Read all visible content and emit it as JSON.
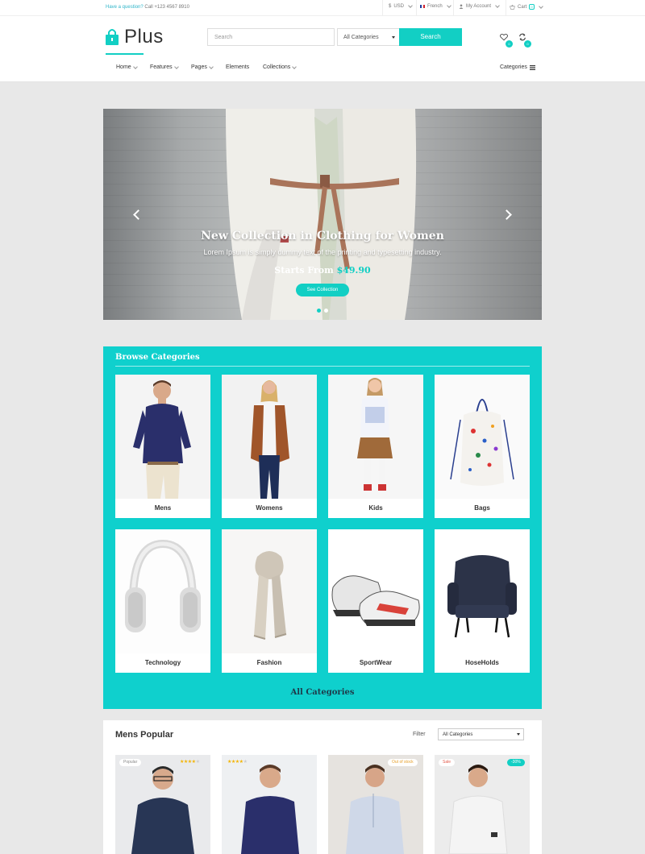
{
  "topbar": {
    "question": "Have a question?",
    "phone": "Call +123 4567 8910",
    "currency": "USD",
    "language": "French",
    "account": "My Account",
    "cart": "Cart",
    "cart_count": "0"
  },
  "header": {
    "logo": "Plus",
    "search_placeholder": "Search",
    "category_select": "All Categories",
    "search_button": "Search",
    "wishlist_count": "0",
    "compare_count": "0"
  },
  "nav": {
    "items": [
      {
        "label": "Home"
      },
      {
        "label": "Features"
      },
      {
        "label": "Pages"
      },
      {
        "label": "Elements"
      },
      {
        "label": "Collections"
      }
    ],
    "categories": "Categories"
  },
  "hero": {
    "title": "New Collection in Clothing for Women",
    "subtitle": "Lorem Ipsum is simply dummy text of the printing and typesetting industry.",
    "price_prefix": "Starts From",
    "price": "$49.90",
    "button": "See Collection",
    "slides": 2,
    "active_slide": 1
  },
  "categories": {
    "title": "Browse Categories",
    "items": [
      "Mens",
      "Womens",
      "Kids",
      "Bags",
      "Technology",
      "Fashion",
      "SportWear",
      "HoseHolds"
    ],
    "all_link": "All Categories"
  },
  "mens_popular": {
    "title": "Mens Popular",
    "filter_label": "Filter",
    "filter_value": "All Categories",
    "products": [
      {
        "badge": "Popular",
        "rating": 4
      },
      {
        "badge": "",
        "rating": 4
      },
      {
        "badge": "Out of stock",
        "rating": 0
      },
      {
        "badge": "Sale",
        "discount": "-30%"
      }
    ],
    "star": "★"
  },
  "colors": {
    "accent": "#12cfc4",
    "category_bg": "#0fd0cd",
    "page_bg": "#e8e8e8"
  }
}
